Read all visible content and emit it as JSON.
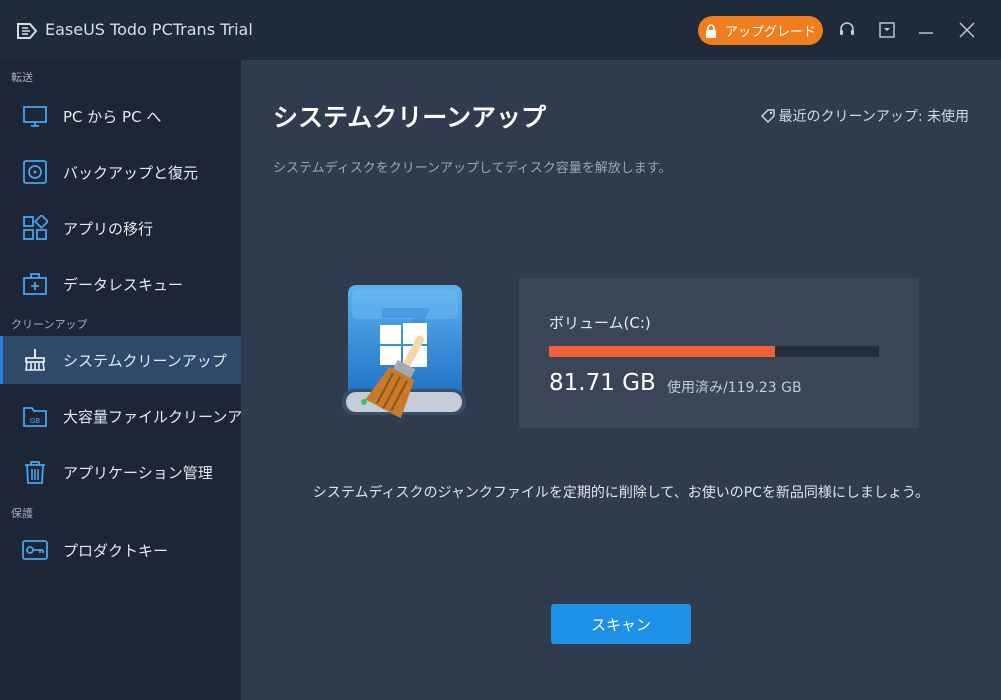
{
  "window": {
    "title": "EaseUS Todo PCTrans Trial",
    "upgrade_label": "アップグレード",
    "controls": [
      "support-icon",
      "menu-icon",
      "minimize-icon",
      "close-icon"
    ]
  },
  "sidebar": {
    "sections": [
      {
        "label": "転送",
        "items": [
          {
            "label": "PC から PC へ",
            "icon": "monitor-icon"
          },
          {
            "label": "バックアップと復元",
            "icon": "disk-icon"
          },
          {
            "label": "アプリの移行",
            "icon": "apps-icon"
          },
          {
            "label": "データレスキュー",
            "icon": "first-aid-kit-icon"
          }
        ]
      },
      {
        "label": "クリーンアップ",
        "items": [
          {
            "label": "システムクリーンアップ",
            "icon": "broom-icon",
            "active": true
          },
          {
            "label": "大容量ファイルクリーンアップ",
            "icon": "gb-folder-icon"
          },
          {
            "label": "アプリケーション管理",
            "icon": "trash-icon"
          }
        ]
      },
      {
        "label": "保護",
        "items": [
          {
            "label": "プロダクトキー",
            "icon": "key-icon"
          }
        ]
      }
    ]
  },
  "main": {
    "title": "システムクリーンアップ",
    "last_cleanup": "最近のクリーンアップ: 未使用",
    "description": "システムディスクをクリーンアップしてディスク容量を解放します。",
    "volume": {
      "name": "ボリューム(C:)",
      "used": "81.71 GB",
      "total": "使用済み/119.23 GB",
      "used_fraction": 0.685
    },
    "tip": "システムディスクのジャンクファイルを定期的に削除して、お使いのPCを新品同様にしましょう。",
    "scan_label": "スキャン"
  },
  "colors": {
    "accent": "#1e90e8",
    "upgrade": "#f07d1e",
    "usage_bar": "#f0603a",
    "sidebar_active": "#2d4a6a"
  }
}
